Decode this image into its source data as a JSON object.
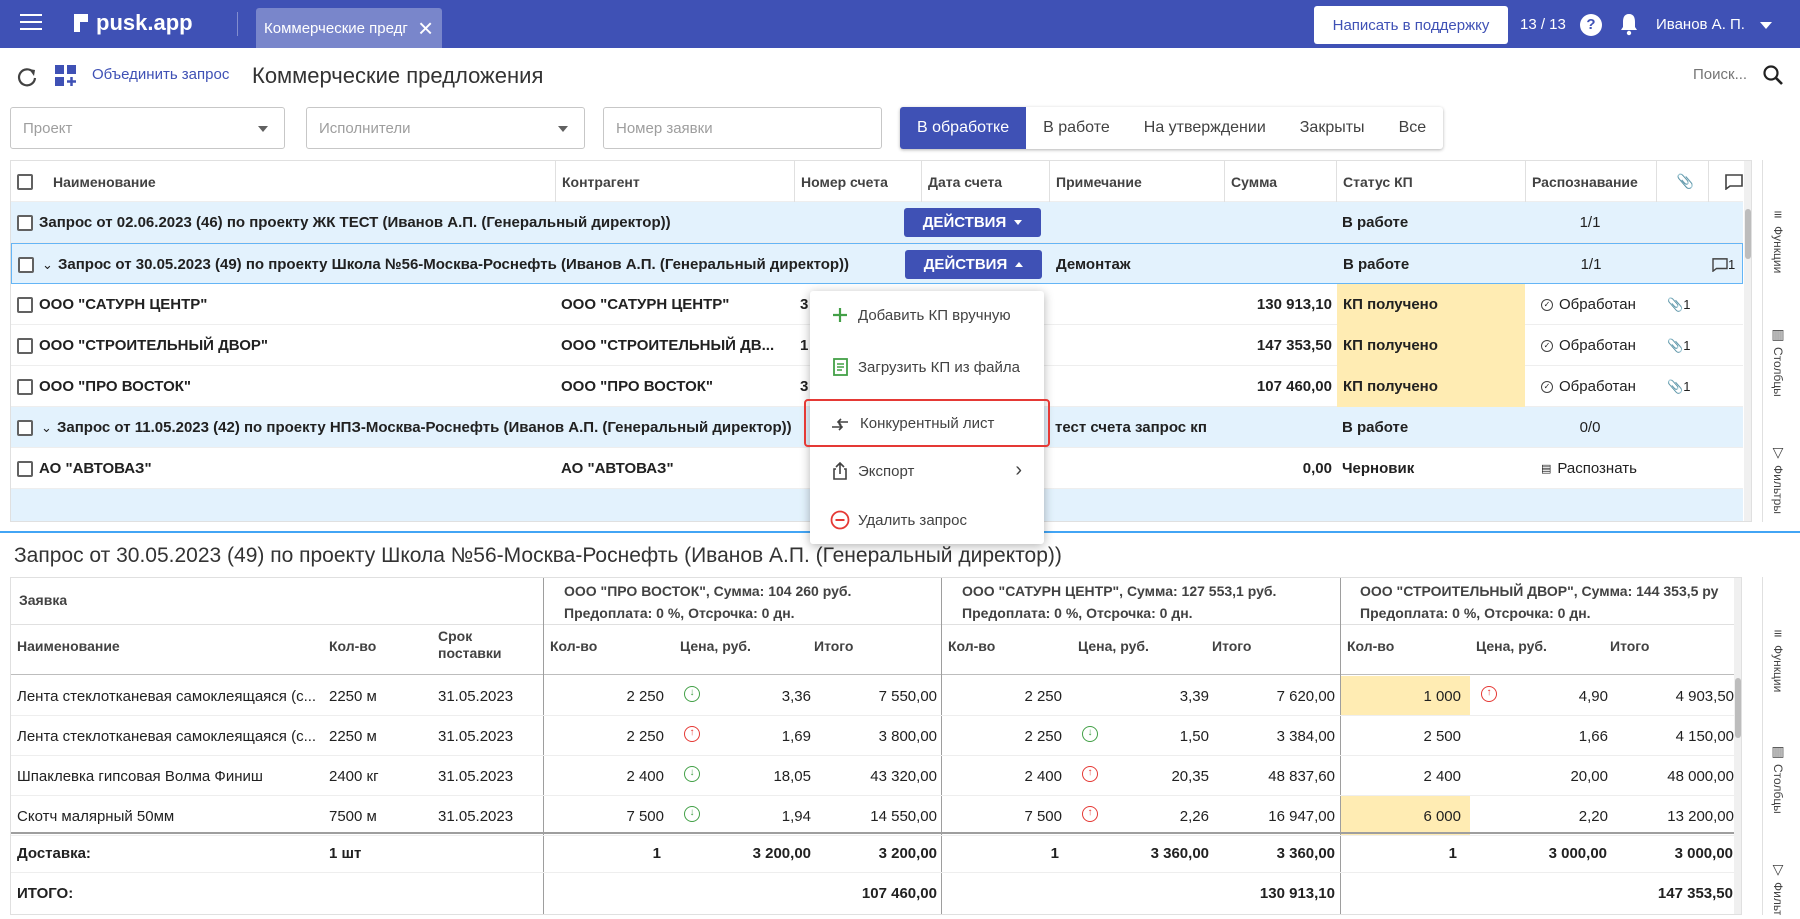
{
  "app": {
    "logo": "pusk.app",
    "tab": "Коммерческие предг",
    "support": "Написать в поддержку",
    "counter": "13 / 13",
    "user": "Иванов А. П."
  },
  "toolbar": {
    "merge": "Объединить запрос",
    "title": "Коммерческие предложения",
    "search": "Поиск..."
  },
  "filters": {
    "project": "Проект",
    "executors": "Исполнители",
    "number": "Номер заявки",
    "tabs": [
      "В обработке",
      "В работе",
      "На утверждении",
      "Закрыты",
      "Все"
    ]
  },
  "side_panel": {
    "functions": "Функции",
    "columns": "Столбцы",
    "filters": "Фильтры"
  },
  "table": {
    "headers": {
      "name": "Наименование",
      "contractor": "Контрагент",
      "invoice": "Номер счета",
      "date": "Дата счета",
      "note": "Примечание",
      "sum": "Сумма",
      "status": "Статус КП",
      "recognition": "Распознавание"
    },
    "actions_label": "ДЕЙСТВИЯ",
    "rows": [
      {
        "name": "Запрос от 02.06.2023 (46) по проекту ЖК ТЕСТ (Иванов А.П. (Генеральный директор))",
        "status": "В работе",
        "recognition": "1/1"
      },
      {
        "name": "Запрос от 30.05.2023 (49) по проекту Школа №56-Москва-Роснефть (Иванов А.П. (Генеральный директор))",
        "note": "Демонтаж",
        "status": "В работе",
        "recognition": "1/1",
        "comments": "1"
      },
      {
        "name": "ООО \"САТУРН ЦЕНТР\"",
        "contractor": "ООО \"САТУРН ЦЕНТР\"",
        "invoice": "3",
        "sum": "130 913,10",
        "status": "КП получено",
        "recognition": "Обработан",
        "files": "1"
      },
      {
        "name": "ООО \"СТРОИТЕЛЬНЫЙ ДВОР\"",
        "contractor": "ООО \"СТРОИТЕЛЬНЫЙ ДВ...",
        "invoice": "1",
        "sum": "147 353,50",
        "status": "КП получено",
        "recognition": "Обработан",
        "files": "1"
      },
      {
        "name": "ООО \"ПРО ВОСТОК\"",
        "contractor": "ООО \"ПРО ВОСТОК\"",
        "invoice": "3",
        "sum": "107 460,00",
        "status": "КП получено",
        "recognition": "Обработан",
        "files": "1"
      },
      {
        "name": "Запрос от 11.05.2023 (42) по проекту НПЗ-Москва-Роснефть (Иванов А.П. (Генеральный директор))",
        "note": "тест счета запрос кп",
        "status": "В работе",
        "recognition": "0/0"
      },
      {
        "name": "АО \"АВТОВАЗ\"",
        "contractor": "АО \"АВТОВАЗ\"",
        "sum": "0,00",
        "status": "Черновик",
        "recognition": "Распознать"
      }
    ]
  },
  "menu": {
    "items": [
      "Добавить КП вручную",
      "Загрузить КП из файла",
      "Конкурентный лист",
      "Экспорт",
      "Удалить запрос"
    ]
  },
  "detail": {
    "title": "Запрос от 30.05.2023 (49) по проекту Школа №56-Москва-Роснефть (Иванов А.П. (Генеральный директор))",
    "request_label": "Заявка",
    "col_name": "Наименование",
    "col_qty": "Кол-во",
    "col_term": "Срок поставки",
    "sub_qty": "Кол-во",
    "sub_price": "Цена, руб.",
    "sub_total": "Итого",
    "suppliers": [
      {
        "line1": "ООО \"ПРО ВОСТОК\", Сумма: 104 260 руб.",
        "line2": "Предоплата: 0 %, Отсрочка: 0 дн."
      },
      {
        "line1": "ООО \"САТУРН ЦЕНТР\", Сумма: 127 553,1 руб.",
        "line2": "Предоплата: 0 %, Отсрочка: 0 дн."
      },
      {
        "line1": "ООО \"СТРОИТЕЛЬНЫЙ ДВОР\", Сумма: 144 353,5 ру",
        "line2": "Предоплата: 0 %, Отсрочка: 0 дн."
      }
    ],
    "items": [
      {
        "name": "Лента стеклотканевая самоклеящаяся (с...",
        "qty": "2250 м",
        "term": "31.05.2023",
        "offers": [
          {
            "q": "2 250",
            "p": "3,36",
            "t": "7 550,00",
            "a": "down"
          },
          {
            "q": "2 250",
            "p": "3,39",
            "t": "7 620,00",
            "a": ""
          },
          {
            "q": "1 000",
            "p": "4,90",
            "t": "4 903,50",
            "a": "up",
            "hl": true
          }
        ]
      },
      {
        "name": "Лента стеклотканевая самоклеящаяся (с...",
        "qty": "2250 м",
        "term": "31.05.2023",
        "offers": [
          {
            "q": "2 250",
            "p": "1,69",
            "t": "3 800,00",
            "a": "up"
          },
          {
            "q": "2 250",
            "p": "1,50",
            "t": "3 384,00",
            "a": "down"
          },
          {
            "q": "2 500",
            "p": "1,66",
            "t": "4 150,00",
            "a": ""
          }
        ]
      },
      {
        "name": "Шпаклевка гипсовая Волма Финиш",
        "qty": "2400 кг",
        "term": "31.05.2023",
        "offers": [
          {
            "q": "2 400",
            "p": "18,05",
            "t": "43 320,00",
            "a": "down"
          },
          {
            "q": "2 400",
            "p": "20,35",
            "t": "48 837,60",
            "a": "up"
          },
          {
            "q": "2 400",
            "p": "20,00",
            "t": "48 000,00",
            "a": ""
          }
        ]
      },
      {
        "name": "Скотч малярный 50мм",
        "qty": "7500 м",
        "term": "31.05.2023",
        "offers": [
          {
            "q": "7 500",
            "p": "1,94",
            "t": "14 550,00",
            "a": "down"
          },
          {
            "q": "7 500",
            "p": "2,26",
            "t": "16 947,00",
            "a": "up"
          },
          {
            "q": "6 000",
            "p": "2,20",
            "t": "13 200,00",
            "a": "",
            "hl": true
          }
        ]
      }
    ],
    "delivery": {
      "label": "Доставка:",
      "qty": "1 шт",
      "offers": [
        {
          "q": "1",
          "p": "3 200,00",
          "t": "3 200,00"
        },
        {
          "q": "1",
          "p": "3 360,00",
          "t": "3 360,00"
        },
        {
          "q": "1",
          "p": "3 000,00",
          "t": "3 000,00"
        }
      ]
    },
    "total": {
      "label": "ИТОГО:",
      "values": [
        "107 460,00",
        "130 913,10",
        "147 353,50"
      ]
    }
  },
  "colors": {
    "primary": "#3f51b5",
    "highlight": "#ffecb3",
    "group_row": "#e3f2fd",
    "up": "#e53935",
    "down": "#43a047"
  }
}
